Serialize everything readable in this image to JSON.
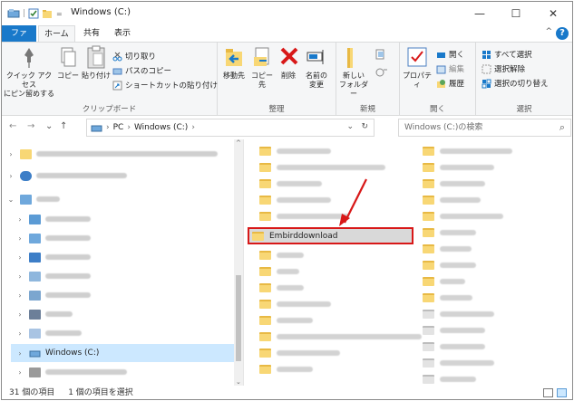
{
  "window": {
    "title": "Windows (C:)",
    "qa_separator": "|",
    "minimize": "—",
    "maximize": "☐",
    "close": "✕"
  },
  "ribbon_tabs": {
    "file": "ファイル",
    "home": "ホーム",
    "share": "共有",
    "view": "表示",
    "help": "?"
  },
  "ribbon": {
    "clipboard": {
      "pin": "クイック アクセス\nにピン留めする",
      "copy": "コピー",
      "paste": "貼り付け",
      "cut": "切り取り",
      "copy_path": "パスのコピー",
      "paste_shortcut": "ショートカットの貼り付け",
      "label": "クリップボード"
    },
    "organize": {
      "move_to": "移動先",
      "copy_to": "コピー先",
      "delete": "削除",
      "rename": "名前の\n変更",
      "label": "整理"
    },
    "new": {
      "new_folder": "新しい\nフォルダー",
      "label": "新規"
    },
    "open": {
      "properties": "プロパティ",
      "open": "開く",
      "edit": "編集",
      "history": "履歴",
      "label": "開く"
    },
    "select": {
      "select_all": "すべて選択",
      "select_none": "選択解除",
      "invert": "選択の切り替え",
      "label": "選択"
    }
  },
  "address": {
    "back": "←",
    "forward": "→",
    "recent": "⌄",
    "up": "↑",
    "crumbs": [
      "PC",
      "Windows (C:)"
    ],
    "separator": "›",
    "dropdown": "⌄",
    "refresh": "↻",
    "search_placeholder": "Windows (C:)の検索",
    "search_icon": "⌕"
  },
  "nav_pane": {
    "selected_label": "Windows (C:)"
  },
  "content": {
    "selected_folder": "Embirddownload"
  },
  "status": {
    "item_count": "31 個の項目",
    "selected": "1 個の項目を選択"
  },
  "colors": {
    "accent": "#1979ca",
    "folder": "#f8d775",
    "highlight_border": "#d81818",
    "arrow": "#d81818",
    "selection": "#cce8ff"
  }
}
